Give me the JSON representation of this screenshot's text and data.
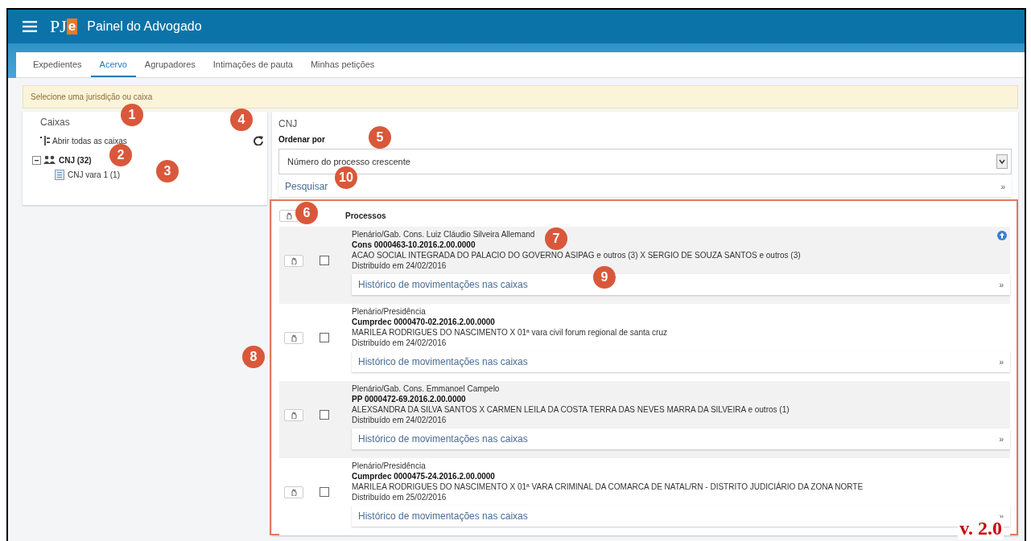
{
  "header": {
    "logo_main": "PJ",
    "logo_accent": "e",
    "title": "Painel do Advogado"
  },
  "tabs": [
    {
      "label": "Expedientes",
      "selected": false
    },
    {
      "label": "Acervo",
      "selected": true
    },
    {
      "label": "Agrupadores",
      "selected": false
    },
    {
      "label": "Intimações de pauta",
      "selected": false
    },
    {
      "label": "Minhas petições",
      "selected": false
    }
  ],
  "alert": "Selecione uma jurisdição ou caixa",
  "sidebar": {
    "title": "Caixas",
    "open_all": {
      "label": "Abrir todas as caixas",
      "callout": "1"
    },
    "refresh_callout": "4",
    "tree": [
      {
        "label": "CNJ (32)",
        "expanded": true,
        "callout": "2",
        "children": [
          {
            "label": "CNJ vara 1 (1)",
            "callout": "3"
          }
        ]
      }
    ]
  },
  "main": {
    "title": "CNJ",
    "sort_label": "Ordenar por",
    "sort": {
      "value": "Número do processo crescente",
      "callout": "5"
    },
    "search": {
      "label": "Pesquisar",
      "chevron": "»",
      "callout": "10"
    },
    "list": {
      "header": "Processos",
      "select_all_callout": "6",
      "callout": "8",
      "rows": [
        {
          "organ": "Plenário/Gab. Cons. Luiz Cláudio Silveira Allemand",
          "number": "Cons 0000463-10.2016.2.00.0000",
          "number_callout": "7",
          "parties": "ACAO SOCIAL INTEGRADA DO PALACIO DO GOVERNO ASIPAG e outros (3) X SERGIO DE SOUZA SANTOS e outros (3)",
          "date": "Distribuído em 24/02/2016",
          "history": "Histórico de movimentações nas caixas",
          "chevron": "»",
          "history_callout": "9",
          "checked": false,
          "shaded": true,
          "top_icon": true
        },
        {
          "organ": "Plenário/Presidência",
          "number": "Cumprdec 0000470-02.2016.2.00.0000",
          "parties": "MARILEA RODRIGUES DO NASCIMENTO X 01ª vara civil forum regional de santa cruz",
          "date": "Distribuído em 24/02/2016",
          "history": "Histórico de movimentações nas caixas",
          "chevron": "»",
          "checked": false,
          "shaded": false,
          "top_icon": false
        },
        {
          "organ": "Plenário/Gab. Cons. Emmanoel Campelo",
          "number": "PP 0000472-69.2016.2.00.0000",
          "parties": "ALEXSANDRA DA SILVA SANTOS X CARMEN LEILA DA COSTA TERRA DAS NEVES MARRA DA SILVEIRA e outros (1)",
          "date": "Distribuído em 24/02/2016",
          "history": "Histórico de movimentações nas caixas",
          "chevron": "»",
          "checked": false,
          "shaded": true,
          "top_icon": false
        },
        {
          "organ": "Plenário/Presidência",
          "number": "Cumprdec 0000475-24.2016.2.00.0000",
          "parties": "MARILEA RODRIGUES DO NASCIMENTO X 01ª VARA CRIMINAL DA COMARCA DE NATAL/RN - DISTRITO JUDICIÁRIO DA ZONA NORTE",
          "date": "Distribuído em 25/02/2016",
          "history": "Histórico de movimentações nas caixas",
          "chevron": "»",
          "checked": false,
          "shaded": false,
          "top_icon": false
        }
      ]
    }
  },
  "version": "v. 2.0"
}
